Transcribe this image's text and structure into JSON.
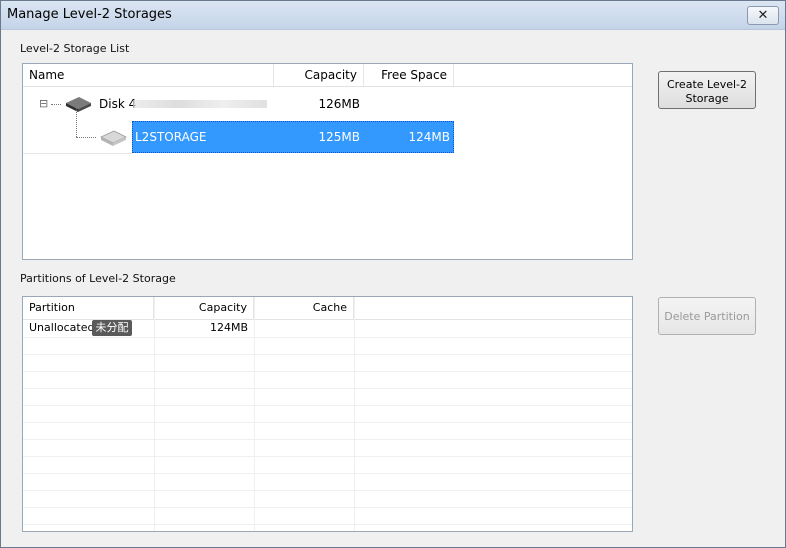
{
  "window": {
    "title": "Manage Level-2 Storages",
    "close_label": "✕"
  },
  "storage_list": {
    "label": "Level-2 Storage List",
    "columns": [
      "Name",
      "Capacity",
      "Free Space"
    ],
    "rows": [
      {
        "name": "Disk 4",
        "capacity": "126MB",
        "free_space": ""
      },
      {
        "name": "L2STORAGE",
        "capacity": "125MB",
        "free_space": "124MB"
      }
    ],
    "expander": "⊟"
  },
  "partitions": {
    "label": "Partitions of Level-2 Storage",
    "columns": [
      "Partition",
      "Capacity",
      "Cache"
    ],
    "rows": [
      {
        "partition": "Unallocated",
        "extra": "未分配",
        "capacity": "124MB",
        "cache": ""
      }
    ]
  },
  "buttons": {
    "create": "Create Level-2 Storage",
    "delete": "Delete Partition"
  },
  "icons": [
    "disk-icon",
    "storage-icon",
    "close-icon",
    "collapse-icon"
  ],
  "colors": {
    "selection": "#3399ff",
    "title_bar": "#c4d4e8"
  }
}
